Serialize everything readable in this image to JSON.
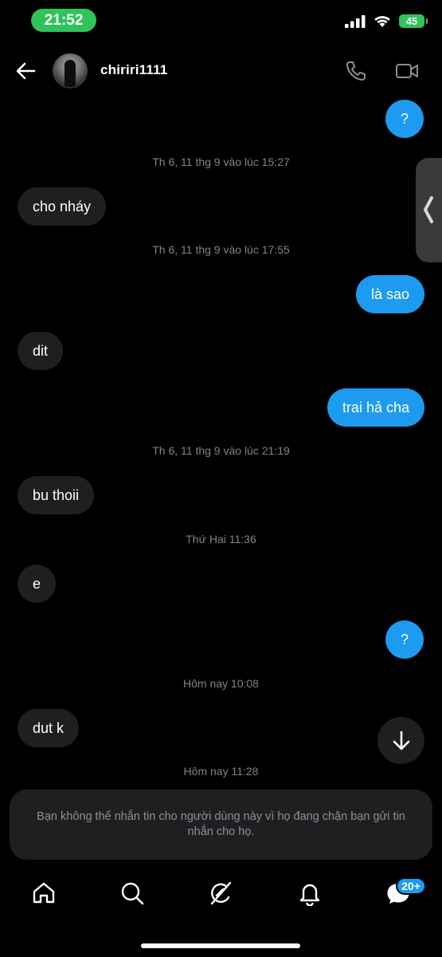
{
  "status_bar": {
    "time": "21:52",
    "battery": "45"
  },
  "header": {
    "username": "chiriri1111"
  },
  "messages": [
    {
      "type": "out",
      "text": "?"
    },
    {
      "type": "timestamp",
      "text": "Th 6, 11 thg 9 vào lúc 15:27"
    },
    {
      "type": "in",
      "text": "cho nháy"
    },
    {
      "type": "timestamp",
      "text": "Th 6, 11 thg 9 vào lúc 17:55"
    },
    {
      "type": "out",
      "text": "là sao"
    },
    {
      "type": "in",
      "text": "dit"
    },
    {
      "type": "out",
      "text": "trai hả cha"
    },
    {
      "type": "timestamp",
      "text": "Th 6, 11 thg 9 vào lúc 21:19"
    },
    {
      "type": "in",
      "text": "bu thoii"
    },
    {
      "type": "timestamp",
      "text": "Thứ Hai 11:36"
    },
    {
      "type": "in",
      "text": "e"
    },
    {
      "type": "out",
      "text": "?"
    },
    {
      "type": "timestamp",
      "text": "Hôm nay 10:08"
    },
    {
      "type": "in",
      "text": "dut k"
    },
    {
      "type": "timestamp",
      "text": "Hôm nay 11:28"
    }
  ],
  "blocked_notice": "Bạn không thể nhắn tin cho người dùng này vì họ đang chặn bạn gửi tin nhắn cho họ.",
  "nav": {
    "items": [
      {
        "icon": "home-icon"
      },
      {
        "icon": "search-icon"
      },
      {
        "icon": "grok-icon"
      },
      {
        "icon": "bell-icon"
      },
      {
        "icon": "messages-icon"
      }
    ],
    "messages_badge": "20+"
  },
  "colors": {
    "accent": "#1d9bf0",
    "incoming_bubble": "#1f1f21",
    "status_green": "#2fc35a",
    "timestamp": "#7f8388"
  }
}
